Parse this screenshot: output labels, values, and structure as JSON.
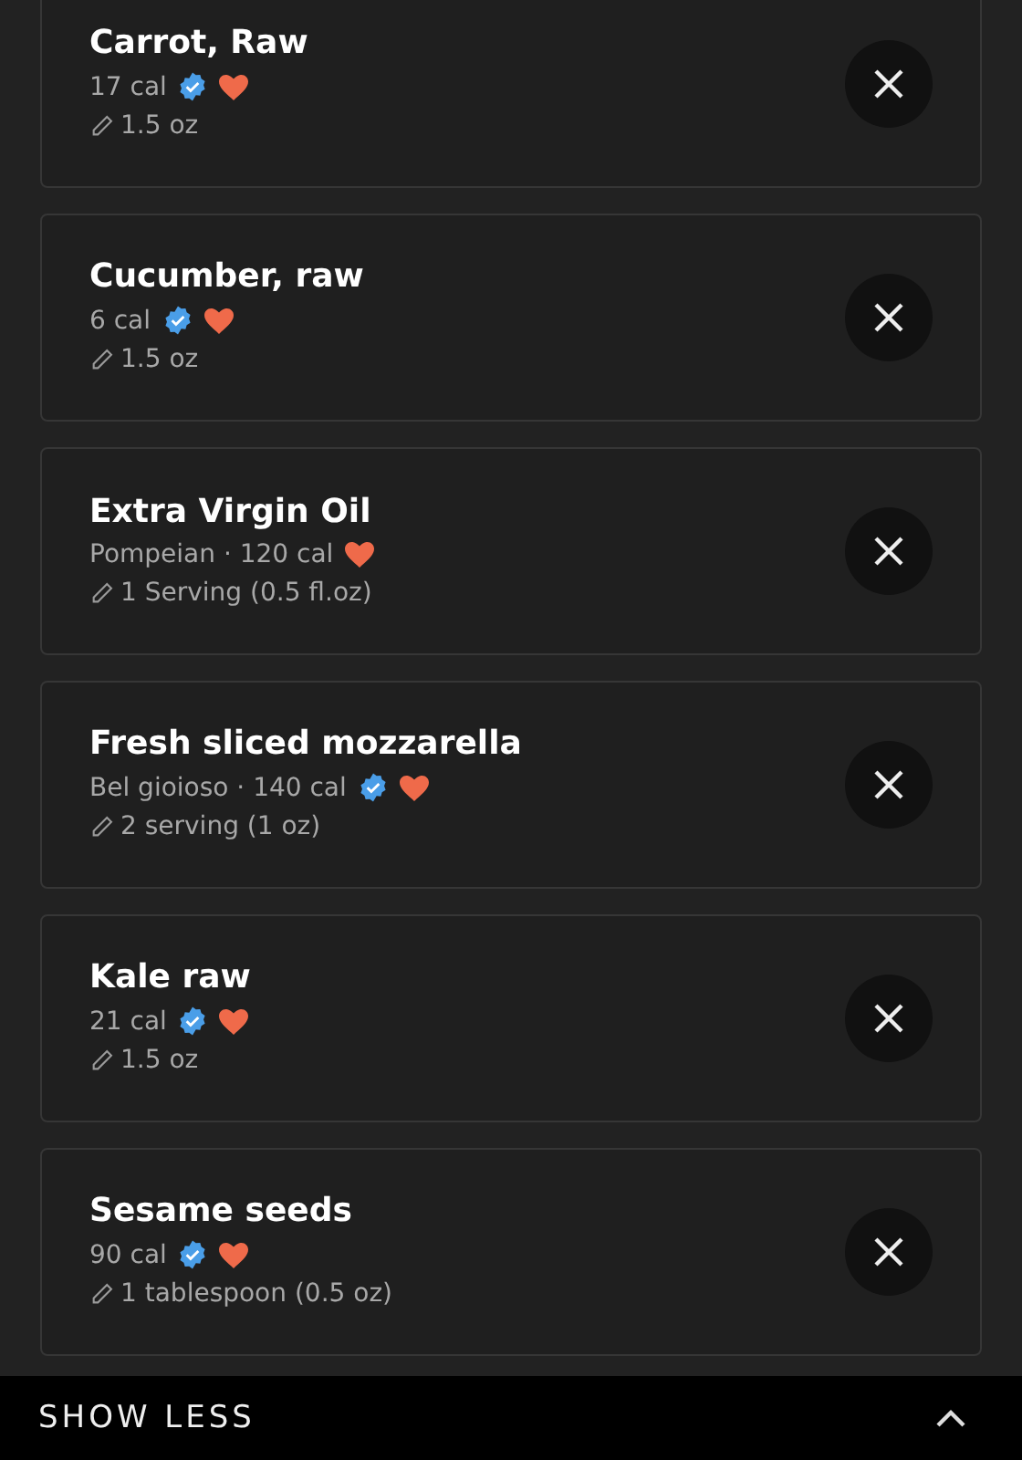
{
  "foods": [
    {
      "name": "Carrot, Raw",
      "details": "17 cal",
      "verified": true,
      "favorite": true,
      "serving": "1.5 oz"
    },
    {
      "name": "Cucumber, raw",
      "details": "6 cal",
      "verified": true,
      "favorite": true,
      "serving": "1.5 oz"
    },
    {
      "name": "Extra Virgin Oil",
      "details": "Pompeian · 120 cal",
      "verified": false,
      "favorite": true,
      "serving": "1 Serving (0.5 fl.oz)"
    },
    {
      "name": "Fresh sliced mozzarella",
      "details": "Bel gioioso · 140 cal",
      "verified": true,
      "favorite": true,
      "serving": "2 serving (1 oz)"
    },
    {
      "name": "Kale raw",
      "details": "21 cal",
      "verified": true,
      "favorite": true,
      "serving": "1.5 oz"
    },
    {
      "name": "Sesame seeds",
      "details": "90 cal",
      "verified": true,
      "favorite": true,
      "serving": "1 tablespoon (0.5 oz)"
    }
  ],
  "footer": {
    "label": "SHOW LESS",
    "expanded": true
  }
}
